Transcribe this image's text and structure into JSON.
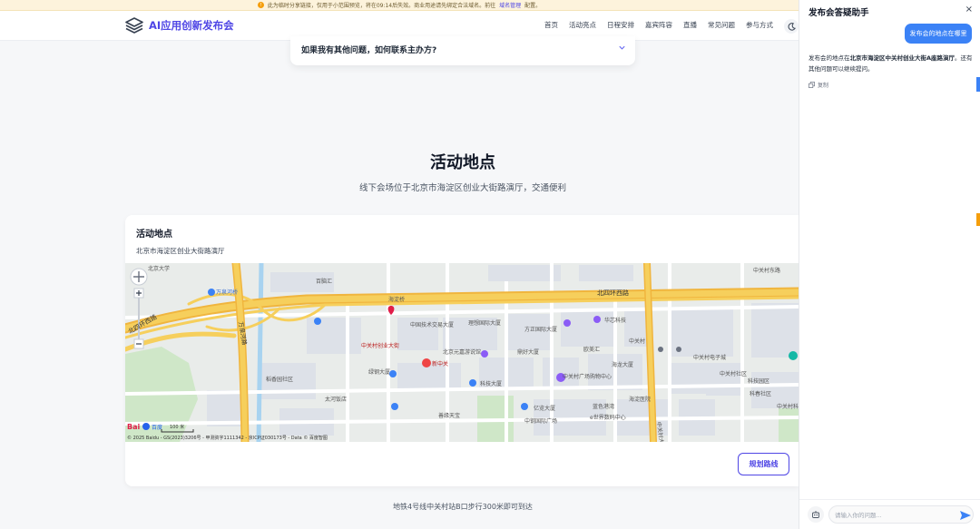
{
  "notice": {
    "text": "此为临时分享链接，仅用于小范围预览，将在09:14后失效。商业用途请先绑定合法域名。前往",
    "link": "域名管理",
    "tail": "配置。"
  },
  "header": {
    "logo_text": "AI应用创新发布会",
    "nav": [
      "首页",
      "活动亮点",
      "日程安排",
      "嘉宾阵容",
      "直播",
      "常见问题",
      "参与方式"
    ]
  },
  "faq": {
    "question": "如果我有其他问题，如何联系主办方?"
  },
  "section": {
    "title": "活动地点",
    "subtitle": "线下会场位于北京市海淀区创业大街路演厅，交通便利"
  },
  "map_card": {
    "title": "活动地点",
    "address": "北京市海淀区创业大街路演厅",
    "route_button": "规划路线",
    "map_labels": {
      "road_north4": "北四环西路",
      "road_north4_w": "北四环西路",
      "road_wanquan": "万泉河路",
      "bridge": "海淀桥",
      "bridge2": "万泉河桥",
      "zhongguancun_st": "中关村大街",
      "beida": "北京大学",
      "b1": "中国技术交易大厦",
      "b2": "理想国际大厦",
      "b3": "方正国际大厦",
      "b4": "华芯科技",
      "b5": "北京元嘉游说馆",
      "b6": "鼎好大厦",
      "b7": "海龙大厦",
      "b8": "中关村广场购物中心",
      "b9": "科技大厦",
      "b10": "欧美汇",
      "b11": "中关村创业大街",
      "b12": "新中关",
      "b13": "亿览大厦",
      "b14": "中钢国际广场",
      "b15": "e世界数码中心",
      "b16": "善缘天宝",
      "b17": "蓝色港湾",
      "b18": "绿钢大厦",
      "b19": "太河饭店",
      "b20": "稻香园社区",
      "b21": "中关村社区",
      "b22": "科技园区",
      "b23": "海淀医院",
      "b24": "中关村电子城",
      "b25": "科春社区",
      "b26": "中关村科学院",
      "b27": "百脑汇",
      "b28": "中关村东路",
      "b29": "中关村",
      "scale": "100 米",
      "brand": "Bai",
      "brand2": "百度",
      "copyright": "© 2025 Baidu - GS(2023)3206号 - 甲测资字1111342 - 京ICP证030173号 - Data © 百度智图"
    }
  },
  "metro": "地铁4号线中关村站B口步行300米即可到达",
  "chat": {
    "title": "发布会答疑助手",
    "close": "×",
    "user_msg": "发布会的地点在哪里",
    "bot_pre": "发布会的地点在",
    "bot_bold": "北京市海淀区中关村创业大街A座路演厅",
    "bot_post": "。还有其他问题可以继续提问。",
    "copy": "复制",
    "input_placeholder": "请输入你的问题..."
  },
  "colors": {
    "accent": "#4f46e5",
    "user_bubble": "#3b82f6",
    "road_yellow": "#f6cf5c",
    "road_orange": "#f0b53e"
  }
}
